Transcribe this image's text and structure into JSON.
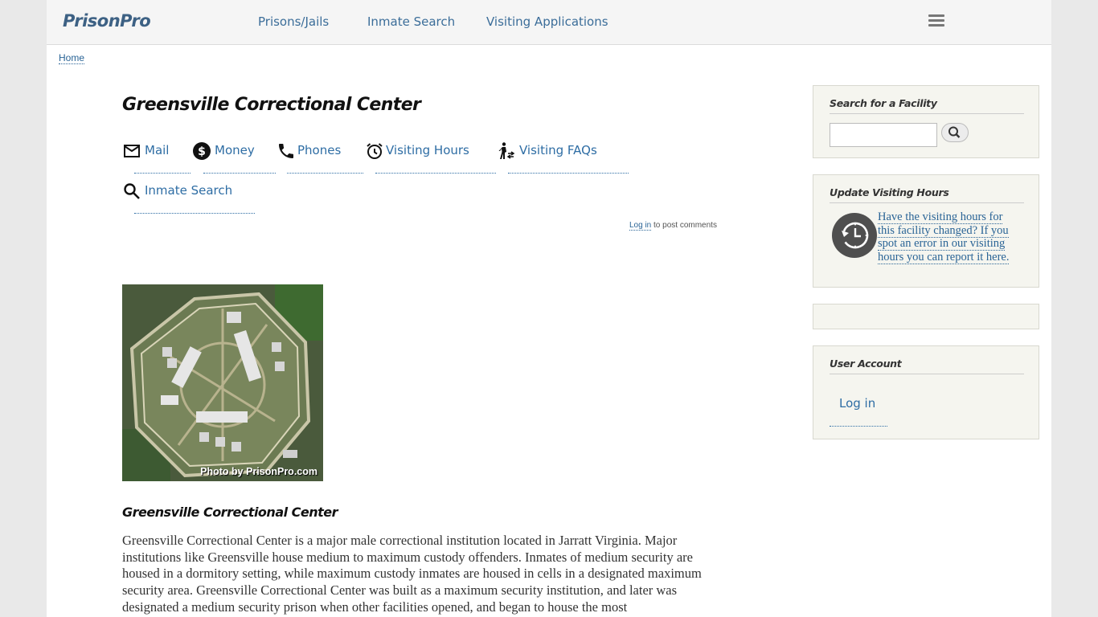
{
  "site": {
    "logo": "PrisonPro"
  },
  "topnav": {
    "items": [
      "Prisons/Jails",
      "Inmate Search",
      "Visiting Applications"
    ]
  },
  "breadcrumb": {
    "home": "Home"
  },
  "page": {
    "title": "Greensville Correctional Center",
    "tabs": [
      {
        "label": "Mail",
        "icon": "mail-icon"
      },
      {
        "label": "Money",
        "icon": "money-icon"
      },
      {
        "label": "Phones",
        "icon": "phone-icon"
      },
      {
        "label": "Visiting Hours",
        "icon": "alarm-clock-icon"
      },
      {
        "label": "Visiting FAQs",
        "icon": "visitor-icon"
      },
      {
        "label": "Inmate Search",
        "icon": "search-icon"
      }
    ],
    "comment_login": "Log in",
    "comment_suffix": " to post comments",
    "photo_caption": "Photo by PrisonPro.com",
    "heading": "Greensville Correctional Center",
    "body": "Greensville Correctional Center is a major male correctional institution located in Jarratt Virginia.  Major institutions like Greensville house medium to maximum custody offenders.  Inmates of medium security are housed in a dormitory setting, while maximum custody inmates are housed in cells in a designated maximum security area.  Greensville Correctional Center was built as a maximum security institution, and later was designated a medium security prison when other facilities opened, and began to house the most"
  },
  "sidebar": {
    "search": {
      "title": "Search for a Facility",
      "placeholder": "",
      "value": ""
    },
    "update": {
      "title": "Update Visiting Hours",
      "link": "Have the visiting hours for this facility changed?  If you spot an error in our visiting hours you can report it here."
    },
    "user": {
      "title": "User Account",
      "login": "Log in"
    }
  },
  "colors": {
    "link": "#2e6da4",
    "logo": "#3d6184",
    "sidebar_bg": "#f5f5ef"
  }
}
